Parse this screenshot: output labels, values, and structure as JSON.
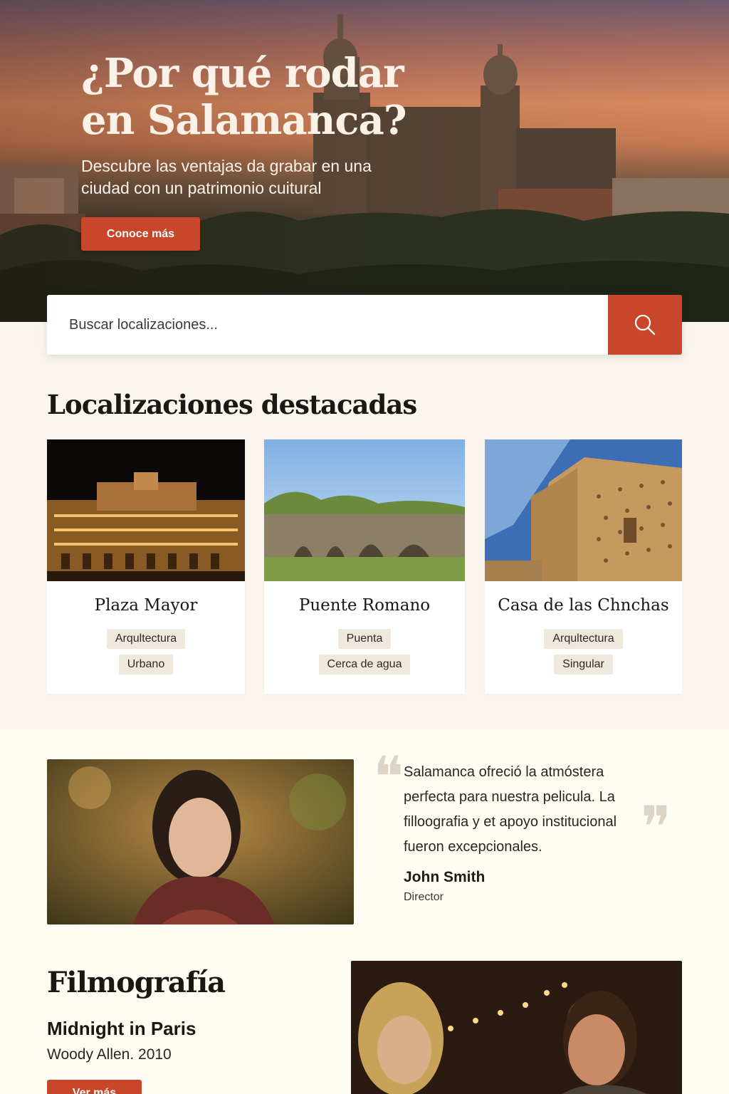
{
  "hero": {
    "title": "¿Por qué rodar en Salamanca?",
    "subtitle": "Descubre las ventajas da grabar en una ciudad con un patrimonio cuitural",
    "cta_label": "Conoce más"
  },
  "search": {
    "placeholder": "Buscar localizaciones..."
  },
  "featured": {
    "title": "Localizaciones destacadas",
    "cards": [
      {
        "name": "Plaza Mayor",
        "tags": [
          "Arqultectura",
          "Urbano"
        ]
      },
      {
        "name": "Puente Romano",
        "tags": [
          "Puenta",
          "Cerca de agua"
        ]
      },
      {
        "name": "Casa de las Chnchas",
        "tags": [
          "Arqultectura",
          "Singular"
        ]
      }
    ]
  },
  "testimonial": {
    "quote": "Salamanca ofreció la atmóstera perfecta para nuestra pelicula. La filloografia y et apoyo institucional fueron excepcionales.",
    "author": "John Smith",
    "role": "Director"
  },
  "filmography": {
    "title": "Filmografía",
    "film_name": "Midnight in Paris",
    "film_meta": "Woody Allen.  2010",
    "cta_label": "Ver más"
  },
  "colors": {
    "accent": "#c8472a",
    "background": "#faf6ef",
    "tag_bg": "#efe8dd"
  }
}
